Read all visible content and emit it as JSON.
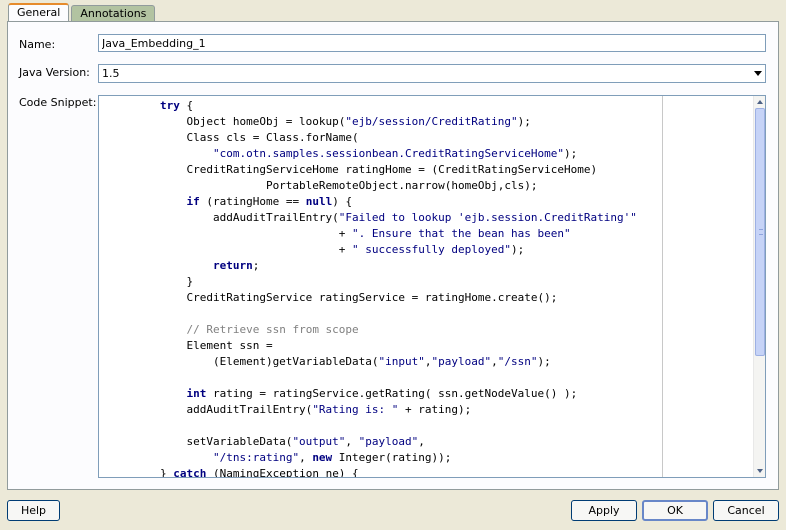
{
  "tabs": [
    {
      "label": "General",
      "active": true
    },
    {
      "label": "Annotations",
      "active": false
    }
  ],
  "form": {
    "name_label": "Name:",
    "name_value": "Java_Embedding_1",
    "java_version_label": "Java Version:",
    "java_version_value": "1.5",
    "code_snippet_label": "Code Snippet:"
  },
  "code_lines": [
    "        try {",
    "            Object homeObj = lookup(\"ejb/session/CreditRating\");",
    "            Class cls = Class.forName(",
    "                \"com.otn.samples.sessionbean.CreditRatingServiceHome\");",
    "            CreditRatingServiceHome ratingHome = (CreditRatingServiceHome)",
    "                        PortableRemoteObject.narrow(homeObj,cls);",
    "            if (ratingHome == null) {",
    "                addAuditTrailEntry(\"Failed to lookup 'ejb.session.CreditRating'\"",
    "                                   + \". Ensure that the bean has been\"",
    "                                   + \" successfully deployed\");",
    "                return;",
    "            }",
    "            CreditRatingService ratingService = ratingHome.create();",
    "",
    "            // Retrieve ssn from scope",
    "            Element ssn =",
    "                (Element)getVariableData(\"input\",\"payload\",\"/ssn\");",
    "",
    "            int rating = ratingService.getRating( ssn.getNodeValue() );",
    "            addAuditTrailEntry(\"Rating is: \" + rating);",
    "",
    "            setVariableData(\"output\", \"payload\",",
    "                \"/tns:rating\", new Integer(rating));",
    "        } catch (NamingException ne) {"
  ],
  "buttons": {
    "help": "Help",
    "apply": "Apply",
    "ok": "OK",
    "cancel": "Cancel"
  },
  "colors": {
    "keyword": "#000080",
    "string": "#000080",
    "comment": "#808080",
    "tab_highlight": "#e68b2c"
  }
}
